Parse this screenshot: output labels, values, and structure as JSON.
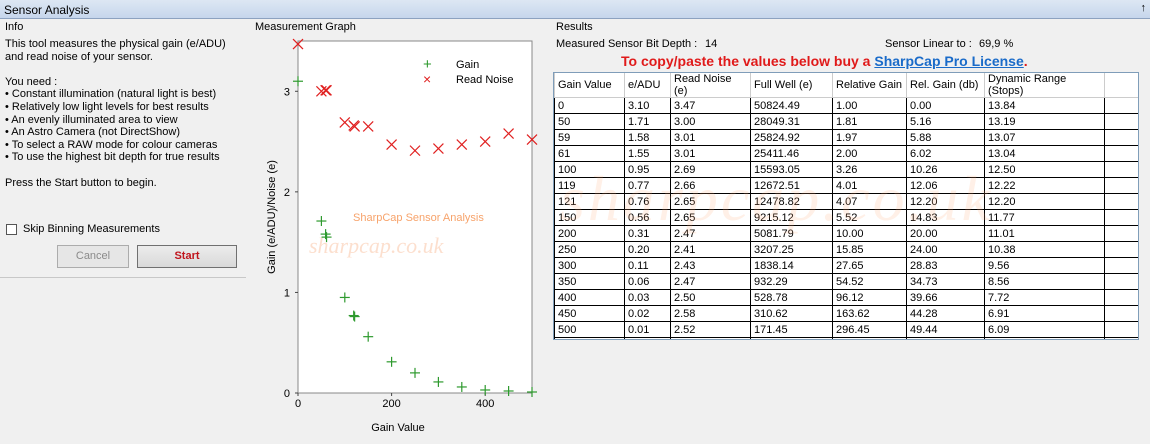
{
  "window": {
    "title": "Sensor Analysis",
    "pin_glyph": "↑"
  },
  "info": {
    "label": "Info",
    "text": "This tool measures the physical gain (e/ADU)\nand read noise of your sensor.\n\nYou need :\n• Constant illumination (natural light is best)\n• Relatively low light levels for best results\n• An evenly illuminated area to view\n• An Astro Camera (not DirectShow)\n• To select a RAW mode for colour cameras\n• To use the highest bit depth for true results\n\nPress the Start button to begin.",
    "skip_label": "Skip Binning Measurements",
    "cancel_label": "Cancel",
    "start_label": "Start"
  },
  "graph": {
    "label": "Measurement Graph"
  },
  "results": {
    "label": "Results",
    "bit_depth_label": "Measured Sensor Bit Depth :",
    "bit_depth_value": "14",
    "linear_label": "Sensor Linear to :",
    "linear_value": "69,9 %",
    "promo_text": "To copy/paste the values below buy a ",
    "promo_link": "SharpCap Pro License",
    "promo_end": ".",
    "watermark": "sharpcap.co.uk",
    "columns": [
      "Gain Value",
      "e/ADU",
      "Read Noise (e)",
      "Full Well (e)",
      "Relative Gain",
      "Rel. Gain (db)",
      "Dynamic Range (Stops)"
    ],
    "rows": [
      [
        "0",
        "3.10",
        "3.47",
        "50824.49",
        "1.00",
        "0.00",
        "13.84"
      ],
      [
        "50",
        "1.71",
        "3.00",
        "28049.31",
        "1.81",
        "5.16",
        "13.19"
      ],
      [
        "59",
        "1.58",
        "3.01",
        "25824.92",
        "1.97",
        "5.88",
        "13.07"
      ],
      [
        "61",
        "1.55",
        "3.01",
        "25411.46",
        "2.00",
        "6.02",
        "13.04"
      ],
      [
        "100",
        "0.95",
        "2.69",
        "15593.05",
        "3.26",
        "10.26",
        "12.50"
      ],
      [
        "119",
        "0.77",
        "2.66",
        "12672.51",
        "4.01",
        "12.06",
        "12.22"
      ],
      [
        "121",
        "0.76",
        "2.65",
        "12478.82",
        "4.07",
        "12.20",
        "12.20"
      ],
      [
        "150",
        "0.56",
        "2.65",
        "9215.12",
        "5.52",
        "14.83",
        "11.77"
      ],
      [
        "200",
        "0.31",
        "2.47",
        "5081.79",
        "10.00",
        "20.00",
        "11.01"
      ],
      [
        "250",
        "0.20",
        "2.41",
        "3207.25",
        "15.85",
        "24.00",
        "10.38"
      ],
      [
        "300",
        "0.11",
        "2.43",
        "1838.14",
        "27.65",
        "28.83",
        "9.56"
      ],
      [
        "350",
        "0.06",
        "2.47",
        "932.29",
        "54.52",
        "34.73",
        "8.56"
      ],
      [
        "400",
        "0.03",
        "2.50",
        "528.78",
        "96.12",
        "39.66",
        "7.72"
      ],
      [
        "450",
        "0.02",
        "2.58",
        "310.62",
        "163.62",
        "44.28",
        "6.91"
      ],
      [
        "500",
        "0.01",
        "2.52",
        "171.45",
        "296.45",
        "49.44",
        "6.09"
      ]
    ]
  },
  "chart_data": {
    "type": "scatter",
    "title": "",
    "subtitle": "SharpCap Sensor Analysis",
    "watermark": "sharpcap.co.uk",
    "xlabel": "Gain Value",
    "ylabel": "Gain (e/ADU)/Noise (e)",
    "xlim": [
      0,
      500
    ],
    "ylim": [
      0,
      3.5
    ],
    "xticks": [
      "0",
      "200",
      "400"
    ],
    "xtick_values": [
      0,
      200,
      400
    ],
    "yticks": [
      "0",
      "1",
      "2",
      "3"
    ],
    "ytick_values": [
      0,
      1,
      2,
      3
    ],
    "legend_position": "top-right",
    "series": [
      {
        "name": "Gain",
        "marker": "+",
        "color": "#2e9a2e",
        "x": [
          0,
          50,
          59,
          61,
          100,
          119,
          121,
          150,
          200,
          250,
          300,
          350,
          400,
          450,
          500
        ],
        "y": [
          3.1,
          1.71,
          1.58,
          1.55,
          0.95,
          0.77,
          0.76,
          0.56,
          0.31,
          0.2,
          0.11,
          0.06,
          0.03,
          0.02,
          0.01
        ]
      },
      {
        "name": "Read Noise",
        "marker": "x",
        "color": "#e02020",
        "x": [
          0,
          50,
          59,
          61,
          100,
          119,
          121,
          150,
          200,
          250,
          300,
          350,
          400,
          450,
          500
        ],
        "y": [
          3.47,
          3.0,
          3.01,
          3.01,
          2.69,
          2.66,
          2.65,
          2.65,
          2.47,
          2.41,
          2.43,
          2.47,
          2.5,
          2.58,
          2.52
        ]
      }
    ]
  }
}
